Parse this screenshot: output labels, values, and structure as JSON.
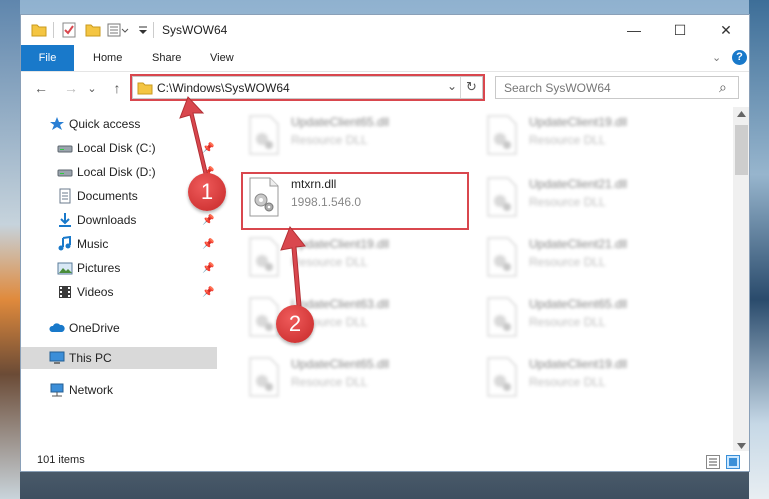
{
  "window": {
    "title": "SysWOW64",
    "minimize_label": "—",
    "maximize_label": "☐",
    "close_label": "✕"
  },
  "ribbon": {
    "tabs": [
      "File",
      "Home",
      "Share",
      "View"
    ],
    "expand_label": "⌄",
    "help_label": "?"
  },
  "navbar": {
    "back": "←",
    "forward": "→",
    "recent": "⌄",
    "up": "↑",
    "address": "C:\\Windows\\SysWOW64",
    "dropdown": "⌄",
    "refresh": "↻",
    "search_placeholder": "Search SysWOW64",
    "search_icon": "⌕"
  },
  "sidebar": {
    "items": [
      {
        "label": "Quick access",
        "icon": "star-icon",
        "pinned": false
      },
      {
        "label": "Local Disk (C:)",
        "icon": "drive-icon",
        "pinned": true
      },
      {
        "label": "Local Disk (D:)",
        "icon": "drive-icon",
        "pinned": true
      },
      {
        "label": "Documents",
        "icon": "documents-icon",
        "pinned": true
      },
      {
        "label": "Downloads",
        "icon": "downloads-icon",
        "pinned": true
      },
      {
        "label": "Music",
        "icon": "music-icon",
        "pinned": true
      },
      {
        "label": "Pictures",
        "icon": "pictures-icon",
        "pinned": true
      },
      {
        "label": "Videos",
        "icon": "videos-icon",
        "pinned": true
      },
      {
        "label": "OneDrive",
        "icon": "cloud-icon",
        "pinned": false
      },
      {
        "label": "This PC",
        "icon": "computer-icon",
        "pinned": false
      },
      {
        "label": "Network",
        "icon": "network-icon",
        "pinned": false
      }
    ],
    "pin_glyph": "📌"
  },
  "files": [
    {
      "name": "UpdateClient65.dll",
      "desc": "Resource DLL",
      "blurred": true
    },
    {
      "name": "UpdateClient19.dll",
      "desc": "Resource DLL",
      "blurred": true
    },
    {
      "name": "mtxrn.dll",
      "desc": "1998.1.546.0",
      "blurred": false
    },
    {
      "name": "UpdateClient21.dll",
      "desc": "Resource DLL",
      "blurred": true
    },
    {
      "name": "UpdateClient19.dll",
      "desc": "Resource DLL",
      "blurred": true
    },
    {
      "name": "UpdateClient21.dll",
      "desc": "Resource DLL",
      "blurred": true
    },
    {
      "name": "UpdateClient63.dll",
      "desc": "Resource DLL",
      "blurred": true
    },
    {
      "name": "UpdateClient65.dll",
      "desc": "Resource DLL",
      "blurred": true
    },
    {
      "name": "UpdateClient65.dll",
      "desc": "Resource DLL",
      "blurred": true
    },
    {
      "name": "UpdateClient19.dll",
      "desc": "Resource DLL",
      "blurred": true
    }
  ],
  "status": {
    "item_count": "101 items"
  },
  "annotations": {
    "badge1": "1",
    "badge2": "2",
    "color": "#d9474e"
  },
  "colors": {
    "file_tab": "#1979ca",
    "selection": "#cce8ff"
  }
}
